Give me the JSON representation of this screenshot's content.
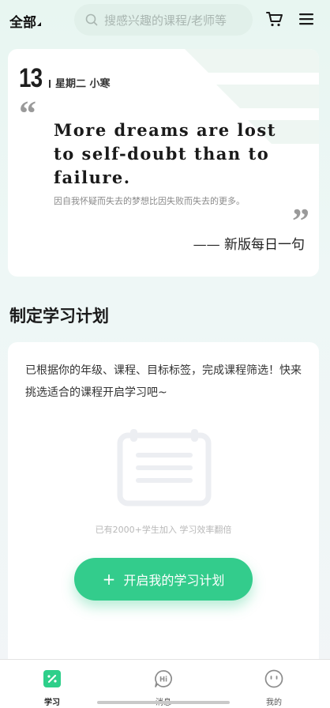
{
  "header": {
    "all_label": "全部",
    "search_placeholder": "搜感兴趣的课程/老师等"
  },
  "quote": {
    "day": "13",
    "weekday_term": "星期二 小寒",
    "text_en": "More dreams are lost to self-doubt than to failure.",
    "text_cn": "因自我怀疑而失去的梦想比因失败而失去的更多。",
    "source": "—— 新版每日一句"
  },
  "plan": {
    "section_title": "制定学习计划",
    "description": "已根据你的年级、课程、目标标签，完成课程筛选！快来挑选适合的课程开启学习吧~",
    "stat": "已有2000+学生加入 学习效率翻倍",
    "cta_plus": "+",
    "cta_label": "开启我的学习计划"
  },
  "tabs": [
    {
      "label": "学习",
      "icon": "study-icon",
      "active": true
    },
    {
      "label": "消息",
      "icon": "message-icon",
      "active": false
    },
    {
      "label": "我的",
      "icon": "profile-icon",
      "active": false
    }
  ],
  "colors": {
    "accent": "#33cc8c",
    "search_bg": "#e1f0ea",
    "tab_active": "#2ecf8a"
  }
}
